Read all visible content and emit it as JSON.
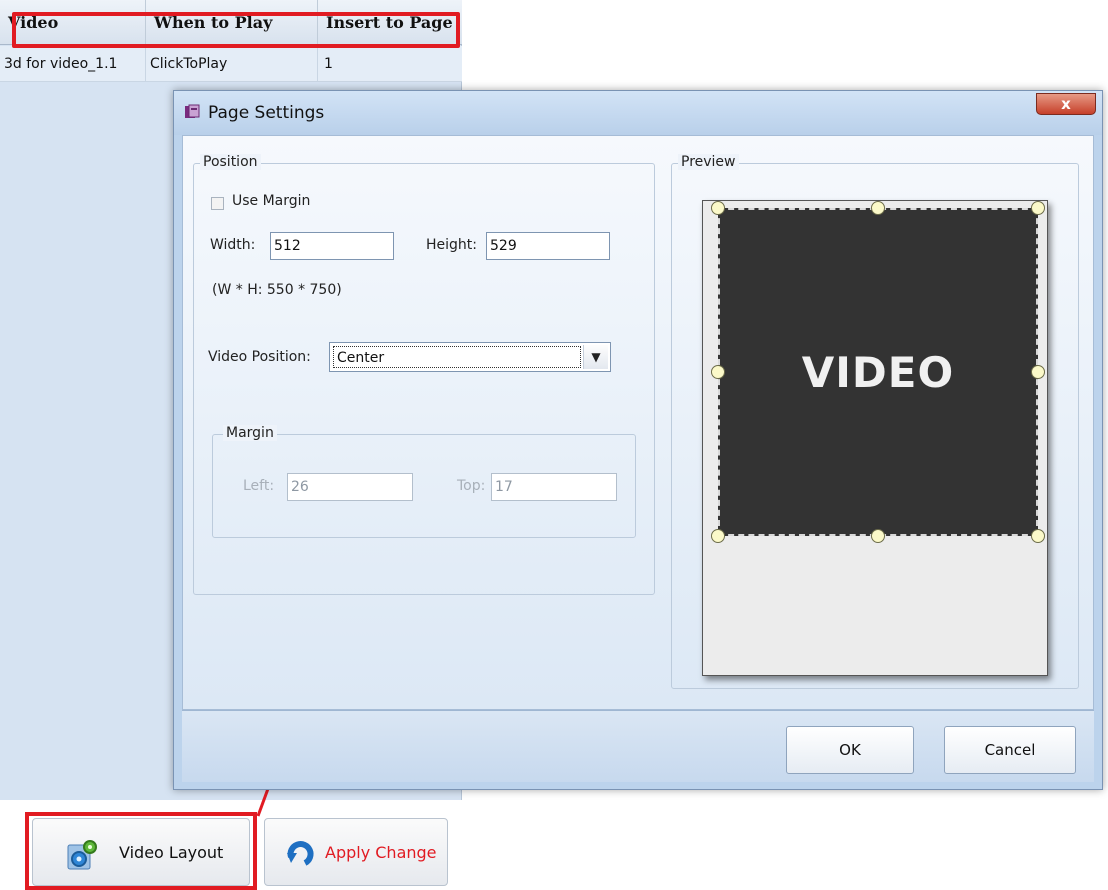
{
  "list": {
    "columns": [
      "Video",
      "When to Play",
      "Insert to Page"
    ],
    "rows": [
      {
        "video": "3d for video_1.1",
        "when": "ClickToPlay",
        "page": "1"
      }
    ]
  },
  "buttons": {
    "video_layout": "Video Layout",
    "apply_change": "Apply Change"
  },
  "dialog": {
    "title": "Page Settings",
    "close_glyph": "x",
    "position": {
      "legend": "Position",
      "use_margin_label": "Use Margin",
      "use_margin_checked": false,
      "width_label": "Width:",
      "width_value": "512",
      "height_label": "Height:",
      "height_value": "529",
      "size_hint": "(W * H: 550 * 750)",
      "video_position_label": "Video Position:",
      "video_position_value": "Center"
    },
    "margin": {
      "legend": "Margin",
      "left_label": "Left:",
      "left_value": "26",
      "top_label": "Top:",
      "top_value": "17"
    },
    "preview": {
      "legend": "Preview",
      "video_text": "VIDEO"
    },
    "ok_label": "OK",
    "cancel_label": "Cancel"
  },
  "colors": {
    "highlight": "#e11b22",
    "apply_change_text": "#e11b22",
    "video_fill": "#333333"
  }
}
